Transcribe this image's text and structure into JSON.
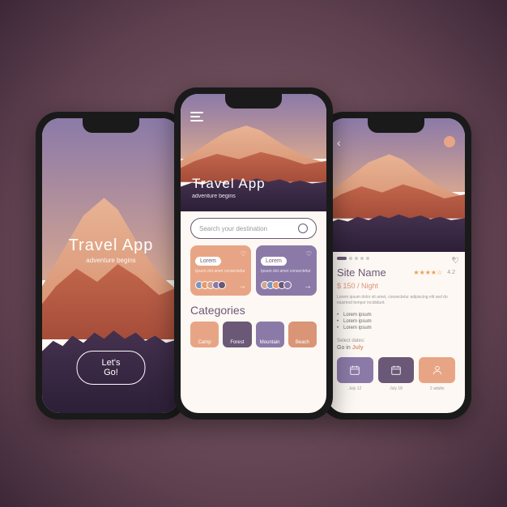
{
  "splash": {
    "title": "Travel App",
    "subtitle": "adventure begins",
    "cta": "Let's Go!"
  },
  "home": {
    "title": "Travel App",
    "subtitle": "adventure begins",
    "search_placeholder": "Search your destination",
    "cards": [
      {
        "label": "Lorem",
        "sub": "Ipsum dot amet consectetur"
      },
      {
        "label": "Lorem",
        "sub": "Ipsum dot amet consectetur"
      }
    ],
    "categories_title": "Categories",
    "categories": [
      {
        "label": "Camp"
      },
      {
        "label": "Forest"
      },
      {
        "label": "Mountain"
      },
      {
        "label": "Beach"
      }
    ]
  },
  "detail": {
    "site_name": "Site Name",
    "rating_stars": "★★★★☆",
    "rating_value": "4.2",
    "price": "$ 150 / Night",
    "desc": "Lorem ipsum dolor sit amet, consectetur adipiscing elit sed do eiusmod tempor incididunt.",
    "bullets": [
      "Lorem ipsum",
      "Lorem ipsum",
      "Lorem ipsum"
    ],
    "select_dates_label": "Select dates:",
    "go_in_prefix": "Go in ",
    "go_in_month": "July",
    "pickers": [
      {
        "label": "July 12"
      },
      {
        "label": "July 18"
      },
      {
        "label": "2 adults"
      }
    ]
  },
  "colors": {
    "purple": "#8b7aa8",
    "dark_purple": "#6b5876",
    "peach": "#e8a585",
    "orange": "#d99575"
  }
}
